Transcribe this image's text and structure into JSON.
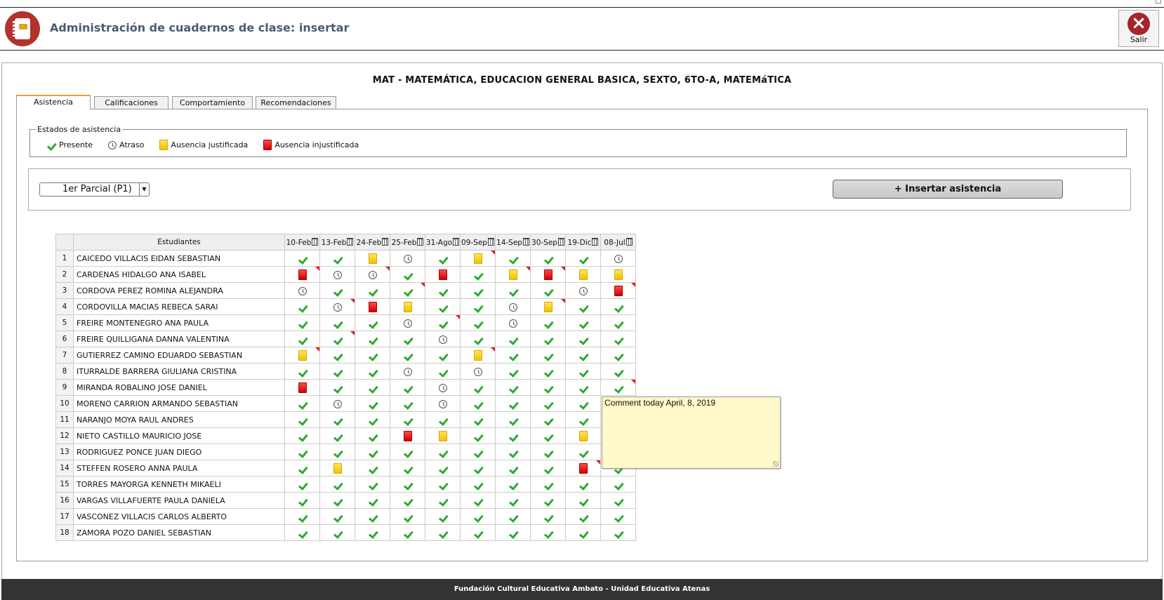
{
  "header": {
    "title": "Administración de cuadernos de clase: insertar",
    "exit_label": "Salir"
  },
  "subject": "MAT - MATEMÁTICA, EDUCACION GENERAL BASICA, SEXTO, 6TO-A, MATEMáTICA",
  "tabs": [
    "Asistencia",
    "Calificaciones",
    "Comportamiento",
    "Recomendaciones"
  ],
  "legend": {
    "title": "Estados de asistencia",
    "items": [
      {
        "code": "P",
        "label": "Presente"
      },
      {
        "code": "A",
        "label": "Atraso"
      },
      {
        "code": "J",
        "label": "Ausencia justificada"
      },
      {
        "code": "I",
        "label": "Ausencia injustificada"
      }
    ]
  },
  "period_select": {
    "value": "1er Parcial (P1)"
  },
  "insert_button": "+ Insertar asistencia",
  "table": {
    "header_students": "Estudiantes",
    "dates": [
      "10-Feb",
      "13-Feb",
      "24-Feb",
      "25-Feb",
      "31-Ago",
      "09-Sep",
      "14-Sep",
      "30-Sep",
      "19-Dic",
      "08-Jul"
    ],
    "rows": [
      {
        "n": "1",
        "name": "CAICEDO VILLACIS EIDAN SEBASTIAN",
        "cells": [
          "P",
          "P",
          "J",
          "A",
          "P",
          "J",
          "P",
          "P",
          "P",
          "A"
        ],
        "comments": [
          5
        ]
      },
      {
        "n": "2",
        "name": "CARDENAS HIDALGO ANA ISABEL",
        "cells": [
          "I",
          "A",
          "A",
          "P",
          "I",
          "P",
          "J",
          "I",
          "J",
          "J"
        ],
        "comments": [
          0,
          2,
          6,
          7
        ]
      },
      {
        "n": "3",
        "name": "CORDOVA PEREZ ROMINA ALEJANDRA",
        "cells": [
          "A",
          "P",
          "P",
          "P",
          "P",
          "P",
          "P",
          "P",
          "A",
          "I"
        ],
        "comments": [
          3,
          9
        ]
      },
      {
        "n": "4",
        "name": "CORDOVILLA MACIAS REBECA SARAI",
        "cells": [
          "P",
          "A",
          "I",
          "J",
          "P",
          "P",
          "A",
          "J",
          "P",
          "P"
        ],
        "comments": [
          1,
          7
        ]
      },
      {
        "n": "5",
        "name": "FREIRE MONTENEGRO ANA PAULA",
        "cells": [
          "P",
          "P",
          "P",
          "A",
          "P",
          "P",
          "A",
          "P",
          "P",
          "P"
        ],
        "comments": [
          4
        ]
      },
      {
        "n": "6",
        "name": "FREIRE QUILLIGANA DANNA VALENTINA",
        "cells": [
          "P",
          "P",
          "P",
          "P",
          "A",
          "P",
          "P",
          "P",
          "P",
          "P"
        ],
        "comments": [
          1
        ]
      },
      {
        "n": "7",
        "name": "GUTIERREZ CAMINO EDUARDO SEBASTIAN",
        "cells": [
          "J",
          "P",
          "P",
          "P",
          "P",
          "J",
          "P",
          "P",
          "P",
          "P"
        ],
        "comments": [
          0,
          5
        ]
      },
      {
        "n": "8",
        "name": "ITURRALDE BARRERA GIULIANA CRISTINA",
        "cells": [
          "P",
          "P",
          "P",
          "A",
          "P",
          "A",
          "P",
          "P",
          "P",
          "P"
        ],
        "comments": []
      },
      {
        "n": "9",
        "name": "MIRANDA ROBALINO JOSE DANIEL",
        "cells": [
          "I",
          "P",
          "P",
          "P",
          "A",
          "P",
          "P",
          "P",
          "P",
          "P"
        ],
        "comments": [
          9
        ]
      },
      {
        "n": "10",
        "name": "MORENO CARRION ARMANDO SEBASTIAN",
        "cells": [
          "P",
          "A",
          "P",
          "P",
          "A",
          "P",
          "P",
          "P",
          "P",
          "P"
        ],
        "comments": []
      },
      {
        "n": "11",
        "name": "NARANJO MOYA RAUL ANDRES",
        "cells": [
          "P",
          "P",
          "P",
          "P",
          "P",
          "P",
          "P",
          "P",
          "P",
          "P"
        ],
        "comments": []
      },
      {
        "n": "12",
        "name": "NIETO CASTILLO MAURICIO JOSE",
        "cells": [
          "P",
          "P",
          "P",
          "I",
          "J",
          "P",
          "P",
          "P",
          "J",
          "P"
        ],
        "comments": []
      },
      {
        "n": "13",
        "name": "RODRIGUEZ PONCE JUAN DIEGO",
        "cells": [
          "P",
          "P",
          "P",
          "P",
          "P",
          "P",
          "P",
          "P",
          "P",
          "P"
        ],
        "comments": []
      },
      {
        "n": "14",
        "name": "STEFFEN ROSERO ANNA PAULA",
        "cells": [
          "P",
          "J",
          "P",
          "P",
          "P",
          "P",
          "P",
          "P",
          "I",
          "P"
        ],
        "comments": [
          8
        ]
      },
      {
        "n": "15",
        "name": "TORRES MAYORGA KENNETH MIKAELI",
        "cells": [
          "P",
          "P",
          "P",
          "P",
          "P",
          "P",
          "P",
          "P",
          "P",
          "P"
        ],
        "comments": []
      },
      {
        "n": "16",
        "name": "VARGAS VILLAFUERTE PAULA DANIELA",
        "cells": [
          "P",
          "P",
          "P",
          "P",
          "P",
          "P",
          "P",
          "P",
          "P",
          "P"
        ],
        "comments": []
      },
      {
        "n": "17",
        "name": "VASCONEZ VILLACIS CARLOS ALBERTO",
        "cells": [
          "P",
          "P",
          "P",
          "P",
          "P",
          "P",
          "P",
          "P",
          "P",
          "P"
        ],
        "comments": []
      },
      {
        "n": "18",
        "name": "ZAMORA POZO DANIEL SEBASTIAN",
        "cells": [
          "P",
          "P",
          "P",
          "P",
          "P",
          "P",
          "P",
          "P",
          "P",
          "P"
        ],
        "comments": []
      }
    ]
  },
  "comment_box": {
    "text": "Comment today April, 8, 2019"
  },
  "footer": "Fundación Cultural Educativa Ambato - Unidad Educativa Atenas",
  "colors": {
    "title": "#4a5b73",
    "exit": "#a8232a",
    "logo": "#b3322c",
    "present": "#2eaa2e",
    "justified": "#f2c200",
    "unjustified": "#d10000",
    "comment_bg": "#fff8c8",
    "footer_bg": "#333333"
  },
  "icons": {
    "logo": "notebook-icon",
    "exit": "close-circle-icon",
    "delete_column": "trash-icon",
    "comment_marker": "red-corner-icon"
  }
}
